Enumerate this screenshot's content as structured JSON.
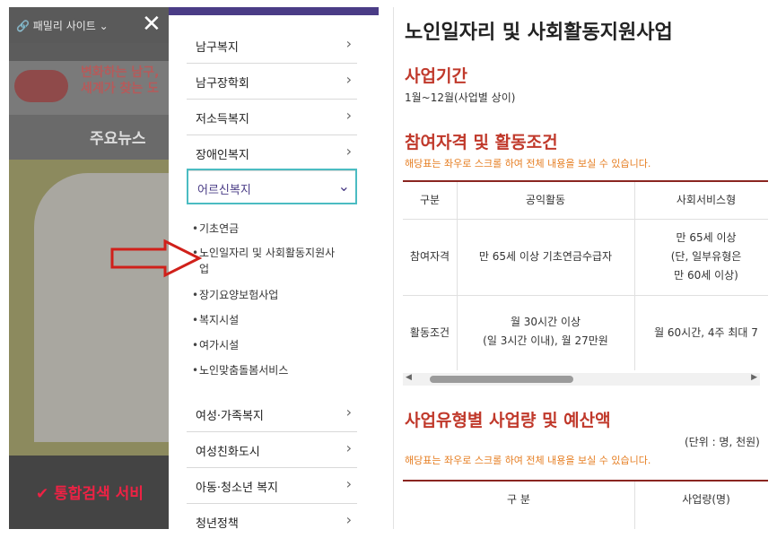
{
  "left": {
    "topbar": {
      "family_site": "패밀리 사이트"
    },
    "banner": {
      "line1": "변화하는 남구,",
      "line2": "세계가 찾는 도"
    },
    "news": "주요뉴스",
    "search": "통합검색 서비",
    "menu": {
      "items": [
        "남구복지",
        "남구장학회",
        "저소득복지",
        "장애인복지",
        "어르신복지",
        "여성·가족복지",
        "여성친화도시",
        "아동·청소년 복지",
        "청년정책"
      ],
      "active": "어르신복지",
      "sub": [
        "기초연금",
        "노인일자리 및 사회활동지원사업",
        "장기요양보험사업",
        "복지시설",
        "여가시설",
        "노인맞춤돌봄서비스"
      ]
    }
  },
  "right": {
    "title": "노인일자리 및 사회활동지원사업",
    "period_h": "사업기간",
    "period": "1월~12월(사업별 상이)",
    "cond_h": "참여자격 및 활동조건",
    "hint1": "해당표는 좌우로 스크롤 하여 전체 내용을 보실 수 있습니다.",
    "table": {
      "headers": [
        "구분",
        "공익활동",
        "사회서비스형"
      ],
      "rows": [
        {
          "label": "참여자격",
          "c1": "만 65세 이상 기초연금수급자",
          "c2a": "만 65세 이상",
          "c2b": "(단, 일부유형은",
          "c2c": "만 60세 이상)"
        },
        {
          "label": "활동조건",
          "c1a": "월 30시간 이상",
          "c1b": "(일 3시간 이내), 월 27만원",
          "c2": "월 60시간, 4주 최대 7"
        }
      ]
    },
    "budget_h": "사업유형별 사업량 및 예산액",
    "unit": "(단위 : 명, 천원)",
    "hint2": "해당표는 좌우로 스크롤 하여 전체 내용을 보실 수 있습니다.",
    "table2": {
      "headers": [
        "구 분",
        "사업량(명)"
      ]
    }
  },
  "colors": {
    "accent": "#4a3c86",
    "red": "#c0392b",
    "hint": "#e67e22",
    "highlight": "#4bbcc2"
  }
}
